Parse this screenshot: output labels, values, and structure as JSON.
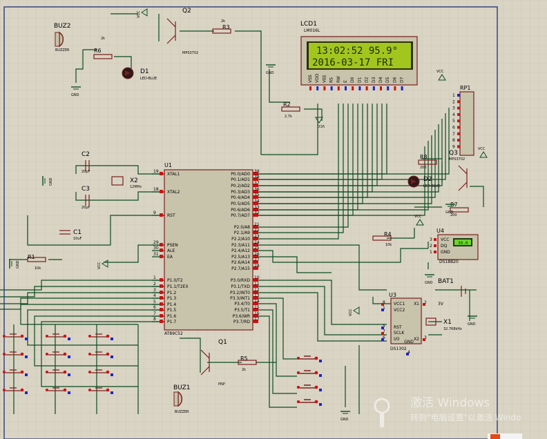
{
  "lcd": {
    "ref": "LCD1",
    "model": "LM016L",
    "line1": "13:02:52  95.9°",
    "line2": "2016-03-17  FRI",
    "pins": [
      "VSS",
      "VDD",
      "VEE",
      "RS",
      "RW",
      "E",
      "D0",
      "D1",
      "D2",
      "D3",
      "D4",
      "D5",
      "D6",
      "D7"
    ]
  },
  "mcu": {
    "ref": "U1",
    "model": "AT89C52",
    "left_pins": [
      {
        "num": "19",
        "name": "XTAL1"
      },
      {
        "num": "18",
        "name": "XTAL2"
      },
      {
        "num": "9",
        "name": "RST"
      },
      {
        "num": "29",
        "name": "PSEN"
      },
      {
        "num": "30",
        "name": "ALE"
      },
      {
        "num": "31",
        "name": "EA"
      },
      {
        "num": "1",
        "name": "P1.0/T2"
      },
      {
        "num": "2",
        "name": "P1.1/T2EX"
      },
      {
        "num": "3",
        "name": "P1.2"
      },
      {
        "num": "4",
        "name": "P1.3"
      },
      {
        "num": "5",
        "name": "P1.4"
      },
      {
        "num": "6",
        "name": "P1.5"
      },
      {
        "num": "7",
        "name": "P1.6"
      },
      {
        "num": "8",
        "name": "P1.7"
      }
    ],
    "right_pins": [
      {
        "num": "39",
        "name": "P0.0/AD0"
      },
      {
        "num": "38",
        "name": "P0.1/AD1"
      },
      {
        "num": "37",
        "name": "P0.2/AD2"
      },
      {
        "num": "36",
        "name": "P0.3/AD3"
      },
      {
        "num": "35",
        "name": "P0.4/AD4"
      },
      {
        "num": "34",
        "name": "P0.5/AD5"
      },
      {
        "num": "33",
        "name": "P0.6/AD6"
      },
      {
        "num": "32",
        "name": "P0.7/AD7"
      },
      {
        "num": "21",
        "name": "P2.0/A8"
      },
      {
        "num": "22",
        "name": "P2.1/A9"
      },
      {
        "num": "23",
        "name": "P2.2/A10"
      },
      {
        "num": "24",
        "name": "P2.3/A11"
      },
      {
        "num": "25",
        "name": "P2.4/A12"
      },
      {
        "num": "26",
        "name": "P2.5/A13"
      },
      {
        "num": "27",
        "name": "P2.6/A14"
      },
      {
        "num": "28",
        "name": "P2.7/A15"
      },
      {
        "num": "10",
        "name": "P3.0/RXD"
      },
      {
        "num": "11",
        "name": "P3.1/TXD"
      },
      {
        "num": "12",
        "name": "P3.2/INT0"
      },
      {
        "num": "13",
        "name": "P3.3/INT1"
      },
      {
        "num": "14",
        "name": "P3.4/T0"
      },
      {
        "num": "15",
        "name": "P3.5/T1"
      },
      {
        "num": "16",
        "name": "P3.6/WR"
      },
      {
        "num": "17",
        "name": "P3.7/RD"
      }
    ]
  },
  "rtc": {
    "ref": "U3",
    "model": "DS1302",
    "pins": [
      "VCC1",
      "VCC2",
      "X1",
      "RST",
      "SCLK",
      "I/O",
      "X2",
      "GND"
    ],
    "pin_nums": [
      "8",
      "1",
      "2",
      "5",
      "7",
      "6",
      "3",
      "4"
    ]
  },
  "sensor": {
    "ref": "U4",
    "model": "DS18B20",
    "pins": [
      "VCC",
      "DQ",
      "GND"
    ],
    "pin_nums": [
      "3",
      "2",
      "1"
    ],
    "reading": "30.0"
  },
  "rp1": {
    "ref": "RP1",
    "pins": [
      "1",
      "2",
      "3",
      "4",
      "5",
      "6",
      "7",
      "8",
      "9"
    ]
  },
  "components": {
    "q2": {
      "ref": "Q2",
      "model": "MPS3702"
    },
    "q3": {
      "ref": "Q3",
      "model": "MPS3702"
    },
    "q1": {
      "ref": "Q1",
      "model": "PNP"
    },
    "r1": {
      "ref": "R1",
      "value": "10k"
    },
    "r2": {
      "ref": "R2",
      "value": "2.7k"
    },
    "r3": {
      "ref": "R3",
      "value": "2k"
    },
    "r4": {
      "ref": "R4",
      "value": "10k"
    },
    "r5": {
      "ref": "R5",
      "value": "2k"
    },
    "r6": {
      "ref": "R6",
      "value": "2k"
    },
    "r7": {
      "ref": "R7",
      "value": "200"
    },
    "r8": {
      "ref": "R8",
      "value": "200"
    },
    "c1": {
      "ref": "C1",
      "value": "10uF"
    },
    "c2": {
      "ref": "C2",
      "value": "20pF"
    },
    "c3": {
      "ref": "C3",
      "value": "20pF"
    },
    "x1": {
      "ref": "X1",
      "value": "32.768kHz"
    },
    "x2": {
      "ref": "X2",
      "value": "12MHz"
    },
    "d1": {
      "ref": "D1",
      "model": "LED-BLUE"
    },
    "d2": {
      "ref": "D2",
      "model": "LED-BLUE"
    },
    "buz1": {
      "ref": "BUZ1",
      "model": "BUZZER"
    },
    "buz2": {
      "ref": "BUZ2",
      "model": "BUZZER"
    },
    "bat1": {
      "ref": "BAT1",
      "value": "3V"
    }
  },
  "rails": {
    "vcc": "VCC",
    "gnd": "GND"
  },
  "watermark": {
    "line1": "激活 Windows",
    "line2": "转到\"电脑设置\"以激活 Windo"
  }
}
